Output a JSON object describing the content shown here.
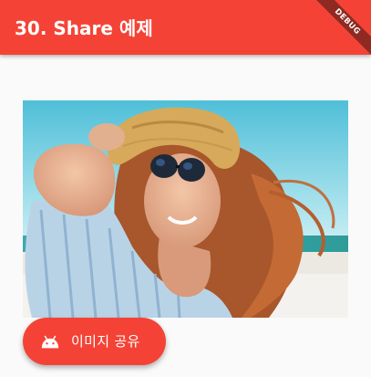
{
  "app_bar": {
    "title": "30. Share 예제",
    "color": "#f44336"
  },
  "debug_banner": {
    "label": "DEBUG"
  },
  "photo": {
    "subject": "woman in straw hat and sunglasses at the beach"
  },
  "share_button": {
    "label": "이미지 공유",
    "icon": "android-icon",
    "color": "#f44336"
  }
}
